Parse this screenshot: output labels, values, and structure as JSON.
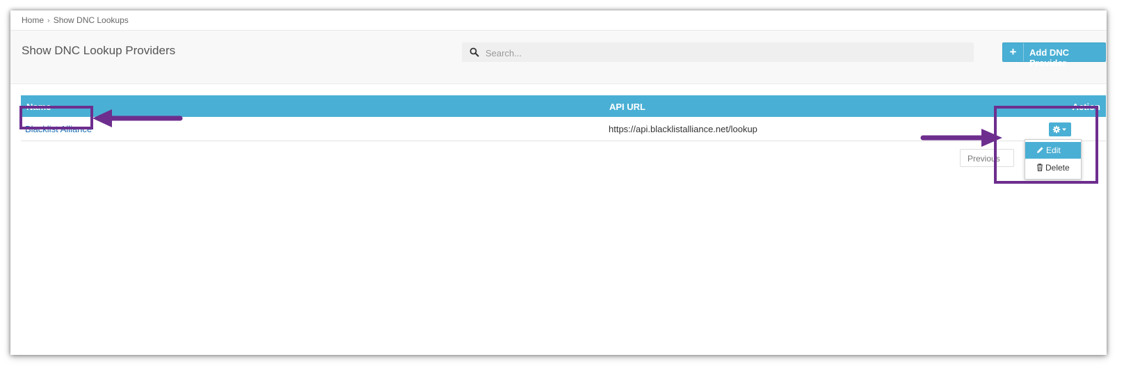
{
  "breadcrumb": {
    "home": "Home",
    "separator": "›",
    "current": "Show DNC Lookups"
  },
  "header": {
    "title": "Show DNC Lookup Providers",
    "search_placeholder": "Search...",
    "add_button_label": "Add DNC Provider",
    "add_button_icon": "+"
  },
  "table": {
    "columns": {
      "name": "Name",
      "api_url": "API URL",
      "action": "Action"
    },
    "rows": [
      {
        "name": "Blacklist Alliance",
        "api_url": "https://api.blacklistalliance.net/lookup"
      }
    ]
  },
  "pagination": {
    "previous": "Previous"
  },
  "action_menu": {
    "edit": "Edit",
    "delete": "Delete"
  },
  "colors": {
    "accent": "#4aafd4",
    "annotation": "#6d2e8e",
    "link": "#1f6fb3"
  },
  "icons": [
    "search-icon",
    "plus-icon",
    "gear-icon",
    "caret-down-icon",
    "pencil-icon",
    "trash-icon",
    "annotation-arrow"
  ]
}
